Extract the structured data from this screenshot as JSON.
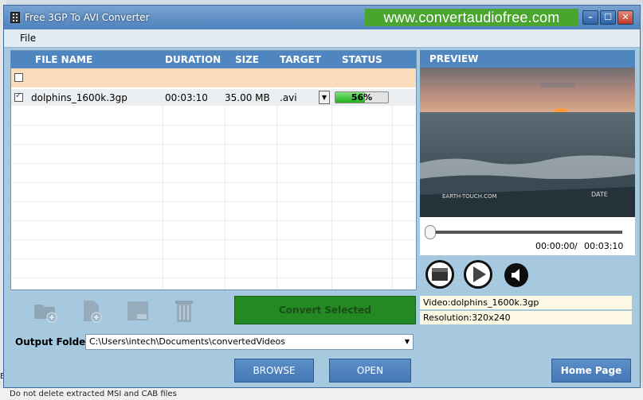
{
  "window": {
    "title": "Free 3GP To AVI Converter",
    "banner": "www.convertaudiofree.com"
  },
  "titlebar_buttons": {
    "minimize": "–",
    "maximize": "☐",
    "close": "✕"
  },
  "menu": {
    "file": "File"
  },
  "list": {
    "headers": {
      "name": "FILE NAME",
      "duration": "DURATION",
      "size": "SIZE",
      "target": "TARGET",
      "status": "STATUS"
    },
    "rows": [
      {
        "checked": true,
        "name": "dolphins_1600k.3gp",
        "duration": "00:03:10",
        "size": "35.00 MB",
        "target": ".avi",
        "progress_percent": 56,
        "status_label": "56%"
      }
    ]
  },
  "toolbar": {
    "icons": [
      "add-folder-icon",
      "add-file-icon",
      "remove-icon",
      "trash-icon"
    ]
  },
  "convert_button": "Convert Selected",
  "output": {
    "label": "Output Folder",
    "path": "C:\\Users\\intech\\Documents\\convertedVideos"
  },
  "buttons": {
    "browse": "BROWSE",
    "open": "OPEN",
    "home": "Home Page"
  },
  "preview": {
    "header": "PREVIEW",
    "current_time": "00:00:00",
    "separator": "/",
    "total_time": "00:03:10",
    "video_caption": "EARTH-TOUCH.COM",
    "video_date": "DATE",
    "info_video": "Video:dolphins_1600k.3gp",
    "info_resolution": "Resolution:320x240"
  },
  "background": {
    "status_text": "Do not delete extracted MSI and CAB files",
    "edge_text": [
      "E",
      "Ex"
    ]
  },
  "colors": {
    "header_blue": "#4f86bf",
    "banner_green": "#4aa52e",
    "progress_green": "#1fb31b",
    "convert_green": "#238a23",
    "checkrow_peach": "#fbdcbb"
  }
}
